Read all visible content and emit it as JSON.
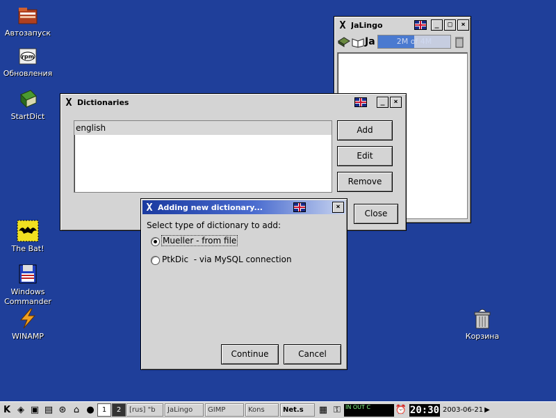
{
  "desktop": {
    "icons": [
      {
        "label": "Автозапуск"
      },
      {
        "label": "Обновления"
      },
      {
        "label": "StartDict"
      },
      {
        "label": "The Bat!"
      },
      {
        "label": "Windows Commander"
      },
      {
        "label": "WINAMP"
      },
      {
        "label": "Корзина"
      }
    ]
  },
  "jalingo": {
    "title": "JaLingo",
    "toolbar_text": "Ja",
    "memory": "2M of 4M",
    "memory_fraction": 0.5
  },
  "dictionaries": {
    "title": "Dictionaries",
    "list": [
      "english"
    ],
    "buttons": {
      "add": "Add",
      "edit": "Edit",
      "remove": "Remove",
      "close": "Close"
    }
  },
  "add_dialog": {
    "title": "Adding new dictionary...",
    "prompt": "Select type of dictionary to add:",
    "options": [
      {
        "label": "Mueller - from file",
        "selected": true
      },
      {
        "label": "PtkDic  - via MySQL connection",
        "selected": false
      }
    ],
    "buttons": {
      "continue": "Continue",
      "cancel": "Cancel"
    }
  },
  "taskbar": {
    "pagers": [
      "1",
      "2"
    ],
    "tasks": [
      "[rus] \"b",
      "JaLingo",
      "GIMP",
      "Kons",
      "Net.s"
    ],
    "clock": "20:30",
    "date": "2003-06-21",
    "tray_text": "IN OUT C"
  },
  "colors": {
    "desktop": "#1f3f9a",
    "active_title": "#1a3aa0",
    "window": "#d4d4d4"
  }
}
